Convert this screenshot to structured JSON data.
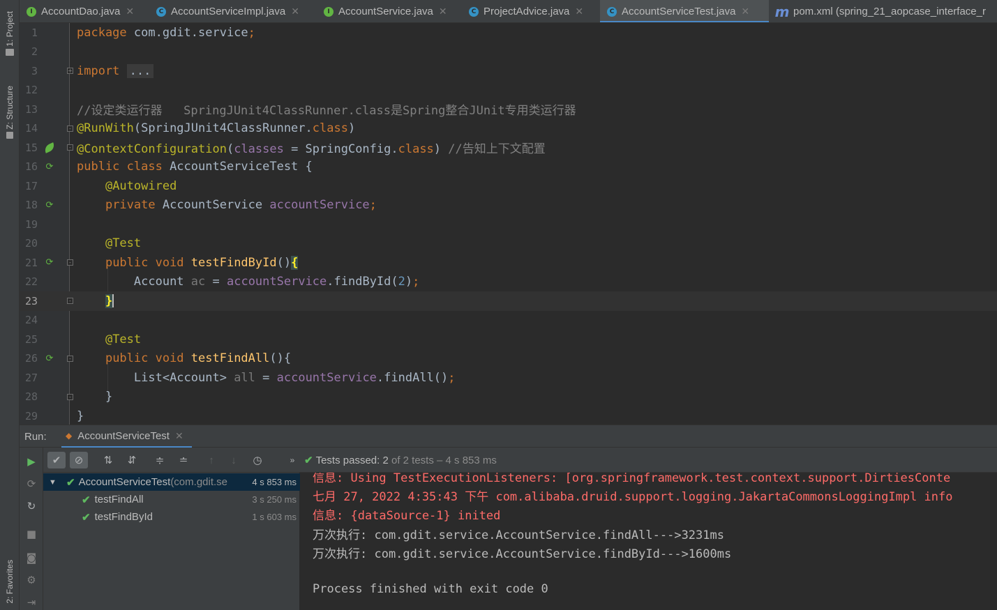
{
  "side_tabs": {
    "project": "1: Project",
    "structure": "Z: Structure",
    "favorites": "2: Favorites"
  },
  "tabs": [
    {
      "label": "AccountDao.java",
      "icon": "interface",
      "active": false
    },
    {
      "label": "AccountServiceImpl.java",
      "icon": "class",
      "active": false
    },
    {
      "label": "AccountService.java",
      "icon": "interface",
      "active": false
    },
    {
      "label": "ProjectAdvice.java",
      "icon": "class",
      "active": false
    },
    {
      "label": "AccountServiceTest.java",
      "icon": "class",
      "active": true
    },
    {
      "label": "pom.xml (spring_21_aopcase_interface_r",
      "icon": "maven",
      "active": false
    }
  ],
  "editor": {
    "line_numbers": [
      "1",
      "2",
      "3",
      "12",
      "13",
      "14",
      "15",
      "16",
      "17",
      "18",
      "19",
      "20",
      "21",
      "22",
      "23",
      "24",
      "25",
      "26",
      "27",
      "28",
      "29"
    ],
    "current_line": "23",
    "code": {
      "l1_kw": "package",
      "l1_rest": " com.gdit.service",
      "l1_semi": ";",
      "l3_kw": "import",
      "l3_folded": "...",
      "l13_comment": "//设定类运行器   SpringJUnit4ClassRunner.class是Spring整合JUnit专用类运行器",
      "l14_ann": "@RunWith",
      "l14_a": "(SpringJUnit4ClassRunner.",
      "l14_kw": "class",
      "l14_b": ")",
      "l15_ann": "@ContextConfiguration",
      "l15_a": "(",
      "l15_attr": "classes",
      "l15_b": " = SpringConfig.",
      "l15_kw": "class",
      "l15_c": ") ",
      "l15_comment": "//告知上下文配置",
      "l16_kw": "public class",
      "l16_rest": " AccountServiceTest {",
      "l17_ann": "@Autowired",
      "l18_kw": "private",
      "l18_type": " AccountService ",
      "l18_field": "accountService",
      "l18_semi": ";",
      "l20_ann": "@Test",
      "l21_kw": "public void",
      "l21_fn": " testFindById",
      "l21_paren": "()",
      "l21_brace": "{",
      "l22_type": "Account ",
      "l22_var": "ac",
      "l22_eq": " = ",
      "l22_field": "accountService",
      "l22_call": ".findById(",
      "l22_num": "2",
      "l22_close": ")",
      "l22_semi": ";",
      "l23_brace": "}",
      "l25_ann": "@Test",
      "l26_kw": "public void",
      "l26_fn": " testFindAll",
      "l26_rest": "(){",
      "l27_type": "List<Account> ",
      "l27_var": "all",
      "l27_eq": " = ",
      "l27_field": "accountService",
      "l27_call": ".findAll()",
      "l27_semi": ";",
      "l28_brace": "}",
      "l29_brace": "}"
    }
  },
  "run": {
    "label": "Run:",
    "tab": "AccountServiceTest",
    "status_prefix": "Tests passed: ",
    "status_count": "2",
    "status_suffix": " of 2 tests – 4 s 853 ms",
    "tree": [
      {
        "name": "AccountServiceTest",
        "pkg": " (com.gdit.se",
        "time": "4 s 853 ms"
      },
      {
        "name": "testFindAll",
        "time": "3 s 250 ms"
      },
      {
        "name": "testFindById",
        "time": "1 s 603 ms"
      }
    ]
  },
  "console": {
    "lines": [
      "信息: Using TestExecutionListeners: [org.springframework.test.context.support.DirtiesConte",
      "七月 27, 2022 4:35:43 下午 com.alibaba.druid.support.logging.JakartaCommonsLoggingImpl info",
      "信息: {dataSource-1} inited",
      "万次执行: com.gdit.service.AccountService.findAll--->3231ms",
      "万次执行: com.gdit.service.AccountService.findById--->1600ms",
      "",
      "Process finished with exit code 0"
    ]
  },
  "colors": {
    "keyword": "#cc7832",
    "annotation": "#bbb529",
    "field": "#9876aa",
    "method": "#ffc66d",
    "number": "#6897bb",
    "pass": "#5fb85f",
    "error_text": "#ff6b68",
    "accent": "#4a88c7"
  }
}
